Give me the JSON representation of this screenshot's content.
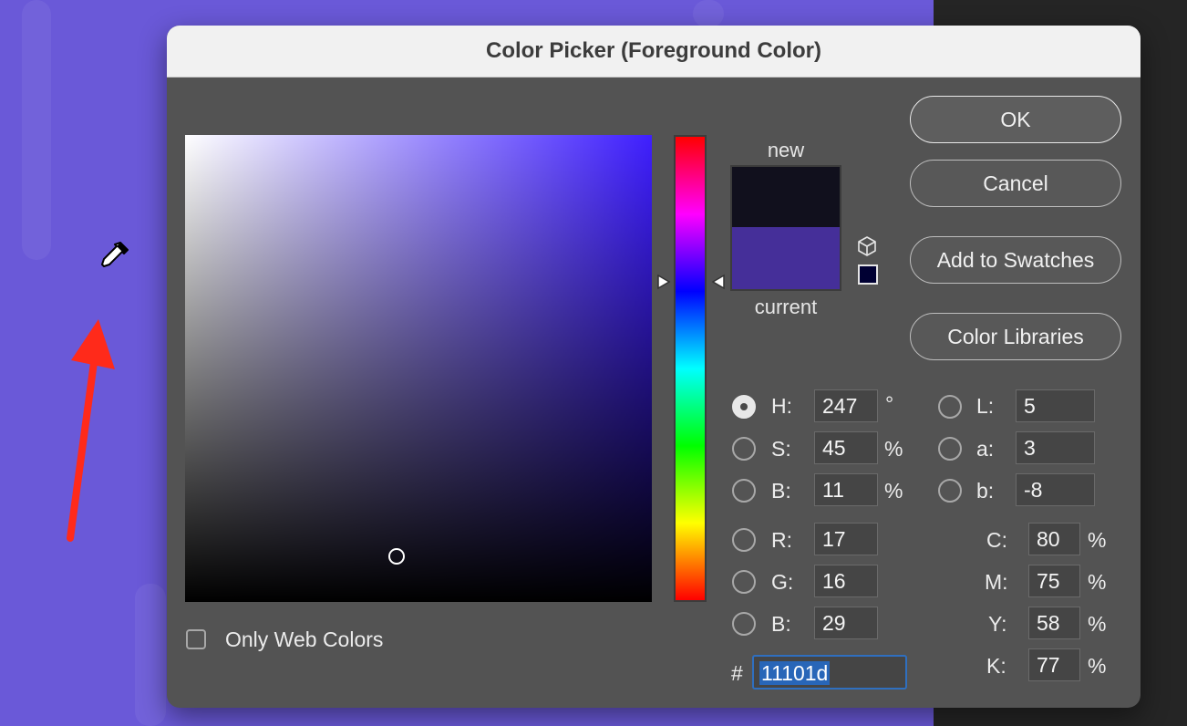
{
  "dialog": {
    "title": "Color Picker (Foreground Color)",
    "colors": {
      "new": "#11101d",
      "current": "#452f99",
      "hue_pure": "#3f1fff"
    },
    "preview": {
      "new_label": "new",
      "current_label": "current"
    },
    "buttons": {
      "ok": "OK",
      "cancel": "Cancel",
      "add_to_swatches": "Add to Swatches",
      "color_libraries": "Color Libraries"
    },
    "hsb": {
      "h": {
        "label": "H:",
        "value": "247",
        "unit": "°",
        "checked": true
      },
      "s": {
        "label": "S:",
        "value": "45",
        "unit": "%"
      },
      "b": {
        "label": "B:",
        "value": "11",
        "unit": "%"
      }
    },
    "lab": {
      "l": {
        "label": "L:",
        "value": "5"
      },
      "a": {
        "label": "a:",
        "value": "3"
      },
      "b": {
        "label": "b:",
        "value": "-8"
      }
    },
    "rgb": {
      "r": {
        "label": "R:",
        "value": "17"
      },
      "g": {
        "label": "G:",
        "value": "16"
      },
      "b": {
        "label": "B:",
        "value": "29"
      }
    },
    "cmyk": {
      "c": {
        "label": "C:",
        "value": "80",
        "unit": "%"
      },
      "m": {
        "label": "M:",
        "value": "75",
        "unit": "%"
      },
      "y": {
        "label": "Y:",
        "value": "58",
        "unit": "%"
      },
      "k": {
        "label": "K:",
        "value": "77",
        "unit": "%"
      }
    },
    "hex": {
      "label": "#",
      "value": "11101d"
    },
    "only_web_colors": {
      "label": "Only Web Colors",
      "checked": false
    }
  },
  "background": {
    "canvas_color": "#6a59d8",
    "annotation_arrow_color": "#ff2a1a",
    "icons": [
      "eyedropper-icon",
      "annotation-arrow"
    ]
  }
}
